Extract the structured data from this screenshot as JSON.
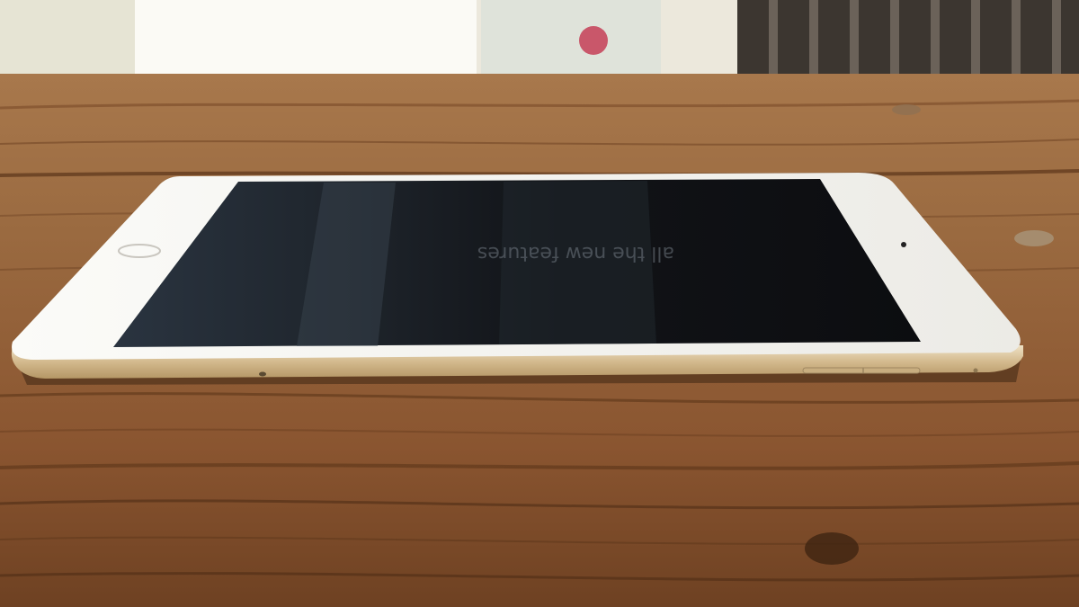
{
  "scene": {
    "subject": "tablet",
    "setting": "wooden table",
    "screen_state": "off",
    "reflected_text": [
      "all the new features"
    ]
  },
  "colors": {
    "wood_light": "#b07a4a",
    "wood_mid": "#8a5530",
    "wood_dark": "#5b3519",
    "bezel": "#f3f1ec",
    "gold_edge": "#d6bd92",
    "screen": "#16181c",
    "background_window": "#f4f2ea"
  }
}
